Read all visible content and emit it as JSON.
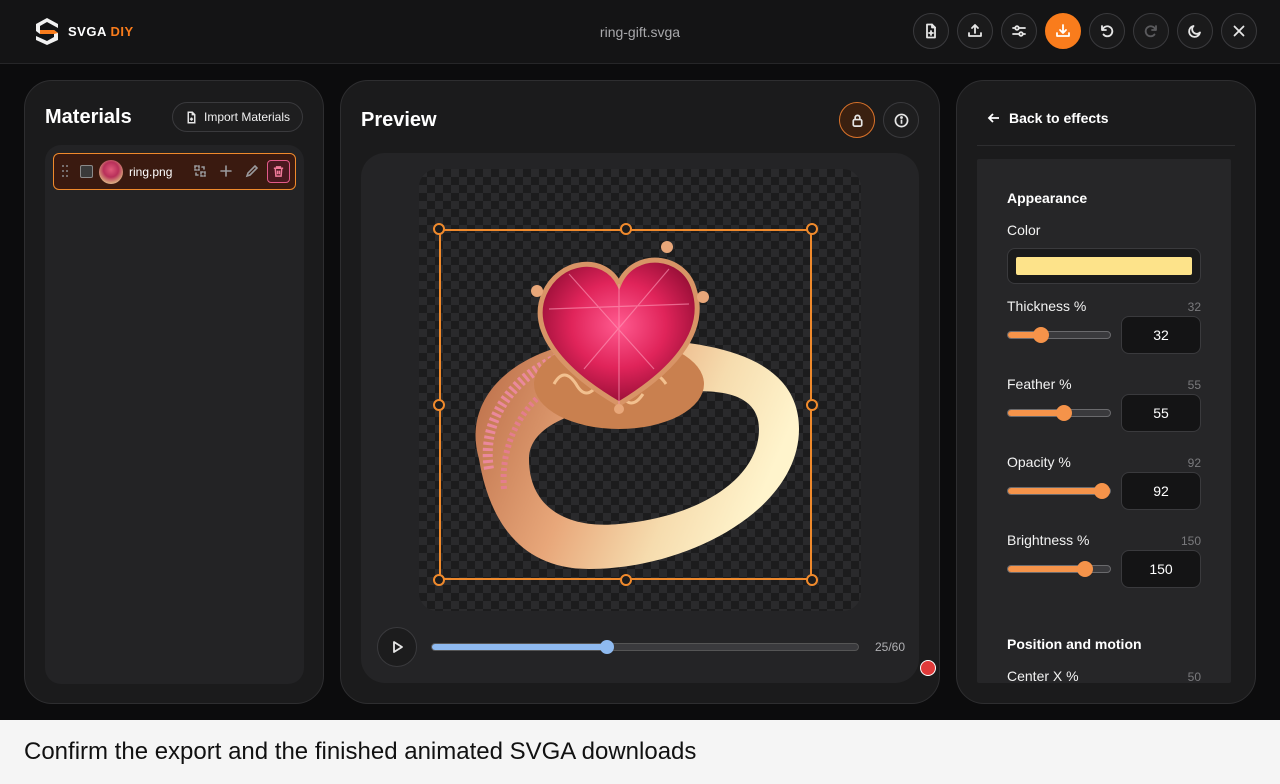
{
  "header": {
    "logo_text": "SVGA",
    "logo_accent": "DIY",
    "file_name": "ring-gift.svga",
    "toolbar": [
      "new-file-icon",
      "upload-icon",
      "settings-sliders-icon",
      "download-icon",
      "undo-icon",
      "redo-icon",
      "moon-icon",
      "close-icon"
    ]
  },
  "materials": {
    "title": "Materials",
    "import_label": "Import Materials",
    "items": [
      {
        "name": "ring.png",
        "selected": true
      }
    ]
  },
  "preview": {
    "title": "Preview",
    "frame_current": 25,
    "frame_total": 60,
    "frame_label": "25/60",
    "progress": 0.41
  },
  "effects": {
    "back_label": "Back to effects",
    "appearance_title": "Appearance",
    "color_label": "Color",
    "color_value": "#fde38a",
    "fields": [
      {
        "label": "Thickness %",
        "value": "32",
        "fraction": 0.32
      },
      {
        "label": "Feather %",
        "value": "55",
        "fraction": 0.55
      },
      {
        "label": "Opacity %",
        "value": "92",
        "fraction": 0.92
      },
      {
        "label": "Brightness %",
        "value": "150",
        "fraction": 0.75
      }
    ],
    "position_title": "Position and motion",
    "center_x_label": "Center X %",
    "center_x_value": "50"
  },
  "caption": "Confirm the export and the finished animated SVGA downloads",
  "colors": {
    "accent": "#f97c1c",
    "timeline": "#8fbaf0",
    "slider": "#f5934a"
  }
}
